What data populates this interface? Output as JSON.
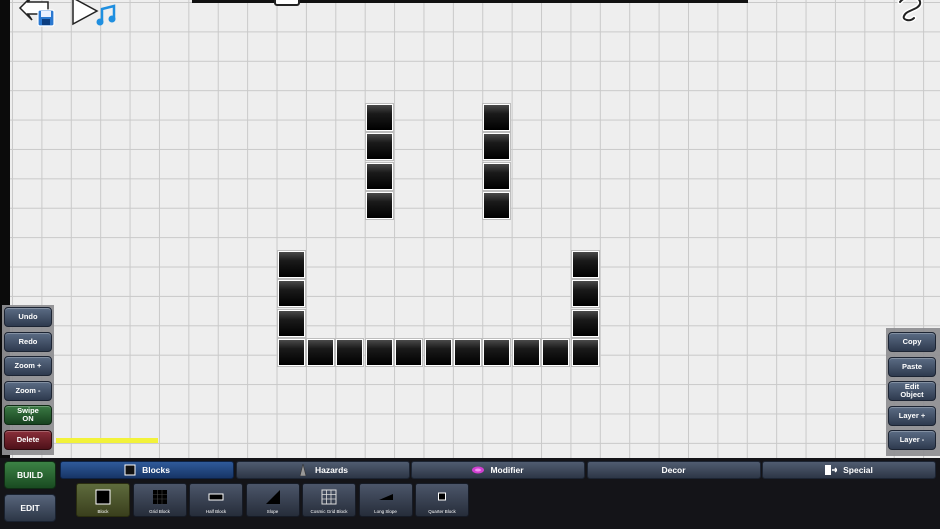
{
  "editor": {
    "left_buttons": [
      {
        "label": "Undo",
        "style": "normal"
      },
      {
        "label": "Redo",
        "style": "normal"
      },
      {
        "label": "Zoom +",
        "style": "normal"
      },
      {
        "label": "Zoom -",
        "style": "normal"
      },
      {
        "label": "Swipe\nON",
        "style": "green"
      },
      {
        "label": "Delete",
        "style": "red"
      }
    ],
    "right_buttons": [
      {
        "label": "Copy"
      },
      {
        "label": "Paste"
      },
      {
        "label": "Edit\nObject"
      },
      {
        "label": "Layer +"
      },
      {
        "label": "Layer -"
      }
    ],
    "level_progress": 0.17
  },
  "modes": {
    "build": "BUILD",
    "edit": "EDIT",
    "active": "build"
  },
  "tabs": [
    {
      "label": "Blocks",
      "icon": "block-square-icon",
      "active": true
    },
    {
      "label": "Hazards",
      "icon": "spike-icon",
      "active": false
    },
    {
      "label": "Modifier",
      "icon": "portal-icon",
      "active": false
    },
    {
      "label": "Decor",
      "icon": "",
      "active": false
    },
    {
      "label": "Special",
      "icon": "trigger-icon",
      "active": false
    }
  ],
  "objects": [
    {
      "label": "Block",
      "icon": "block-icon",
      "selected": true
    },
    {
      "label": "Grid Block",
      "icon": "grid-block-icon",
      "selected": false
    },
    {
      "label": "Half Block",
      "icon": "half-block-icon",
      "selected": false
    },
    {
      "label": "Slope",
      "icon": "slope-icon",
      "selected": false
    },
    {
      "label": "Cosmic Grid Block",
      "icon": "cosmic-grid-block-icon",
      "selected": false
    },
    {
      "label": "Long Slope",
      "icon": "long-slope-icon",
      "selected": false
    },
    {
      "label": "Quarter Block",
      "icon": "quarter-block-icon",
      "selected": false
    }
  ],
  "colors": {
    "accent_green": "#3c8245",
    "accent_blue": "#2f5a9a",
    "delete_red": "#8a2f3a",
    "selection_yellow": "#f2f23a",
    "portal_magenta": "#d040d0"
  }
}
